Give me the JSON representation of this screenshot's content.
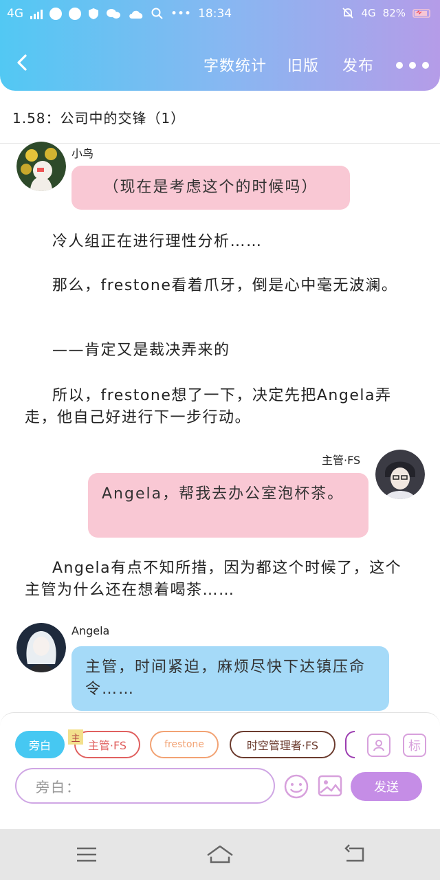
{
  "status_bar": {
    "network_left": "4G",
    "time": "18:34",
    "network_right": "4G",
    "battery": "82%"
  },
  "nav": {
    "word_count": "字数统计",
    "old_version": "旧版",
    "publish": "发布"
  },
  "chapter_title": "1.58：公司中的交锋（1）",
  "messages": [
    {
      "speaker": "小鸟",
      "text": "（现在是考虑这个的时候吗）"
    },
    {
      "speaker": "主管·FS",
      "text": "Angela，帮我去办公室泡杯茶。"
    },
    {
      "speaker": "Angela",
      "text": "主管，时间紧迫，麻烦尽快下达镇压命令……"
    }
  ],
  "narrations": [
    "冷人组正在进行理性分析……",
    "那么，frestone看着爪牙，倒是心中毫无波澜。",
    "——肯定又是裁决弄来的",
    "所以，frestone想了一下，决定先把Angela弄走，他自己好进行下一步行动。",
    "Angela有点不知所措，因为都这个时候了，这个主管为什么还在想着喝茶……"
  ],
  "composer": {
    "roles": [
      {
        "label": "旁白",
        "color": "#46c8f2"
      },
      {
        "label": "主管·FS",
        "color": "#e0605f",
        "badge": "主"
      },
      {
        "label": "frestone",
        "color": "#f2a273"
      },
      {
        "label": "时空管理者·FS",
        "color": "#6b3b2e"
      }
    ],
    "tag_button": "标",
    "input_placeholder": "旁白：",
    "send_label": "发送"
  },
  "colors": {
    "header_gradient_start": "#52c8f3",
    "header_gradient_end": "#b59ce8",
    "pink_bubble": "#f9c8d4",
    "blue_bubble": "#a5daf8",
    "send_button": "#c58de6"
  }
}
